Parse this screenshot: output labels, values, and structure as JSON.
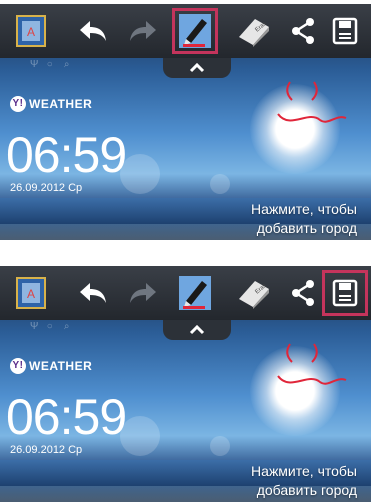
{
  "toolbar": {
    "items": [
      {
        "id": "gallery",
        "icon": "gallery-thumbnail-icon"
      },
      {
        "id": "undo",
        "icon": "undo-arrow-icon"
      },
      {
        "id": "redo",
        "icon": "redo-arrow-icon"
      },
      {
        "id": "pen",
        "icon": "pen-icon"
      },
      {
        "id": "eraser",
        "icon": "eraser-icon"
      },
      {
        "id": "share",
        "icon": "share-icon"
      },
      {
        "id": "save",
        "icon": "floppy-save-icon"
      }
    ],
    "selected_top": "pen",
    "selected_bottom": [
      "pen",
      "save"
    ],
    "highlight_color": "#c4345c",
    "handle_icon": "chevron-up-icon"
  },
  "widget": {
    "brand": "WEATHER",
    "time": "06:59",
    "date": "26.09.2012 Ср",
    "cta_line1": "Нажмите, чтобы",
    "cta_line2": "добавить город"
  },
  "colors": {
    "pen_stroke": "#e0263a",
    "toolbar_bg": "#2a2e35",
    "sky": "#4f8fcf"
  }
}
